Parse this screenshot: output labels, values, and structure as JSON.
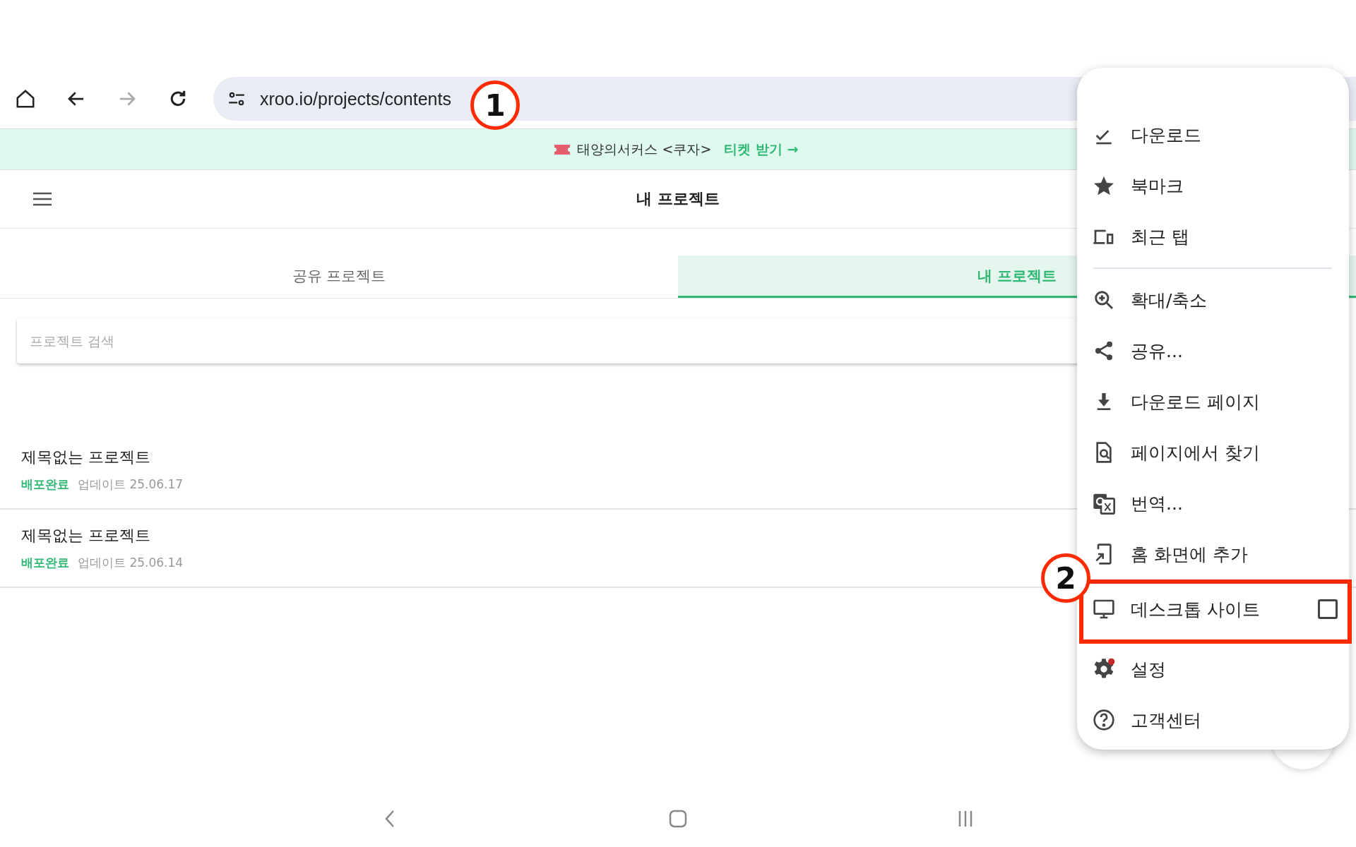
{
  "browser": {
    "url": "xroo.io/projects/contents"
  },
  "banner": {
    "text": "태양의서커스 <쿠자>",
    "link": "티켓 받기 →"
  },
  "header": {
    "title": "내 프로젝트"
  },
  "tabs": [
    {
      "label": "공유 프로젝트",
      "selected": false
    },
    {
      "label": "내 프로젝트",
      "selected": true
    }
  ],
  "search": {
    "placeholder": "프로젝트 검색"
  },
  "projects": [
    {
      "title": "제목없는 프로젝트",
      "status": "배포완료",
      "updated": "업데이트 25.06.17"
    },
    {
      "title": "제목없는 프로젝트",
      "status": "배포완료",
      "updated": "업데이트 25.06.14"
    }
  ],
  "menu": {
    "groups": [
      [
        {
          "label": "다운로드"
        },
        {
          "label": "북마크"
        },
        {
          "label": "최근 탭"
        }
      ],
      [
        {
          "label": "확대/축소"
        },
        {
          "label": "공유..."
        },
        {
          "label": "다운로드 페이지"
        },
        {
          "label": "페이지에서 찾기"
        },
        {
          "label": "번역..."
        },
        {
          "label": "홈 화면에 추가"
        },
        {
          "label": "데스크톱 사이트",
          "kind": "checkbox",
          "checked": false,
          "highlighted": true
        },
        {
          "label": "설정"
        },
        {
          "label": "고객센터"
        }
      ]
    ]
  },
  "annotations": [
    {
      "label": "1"
    },
    {
      "label": "2"
    }
  ]
}
